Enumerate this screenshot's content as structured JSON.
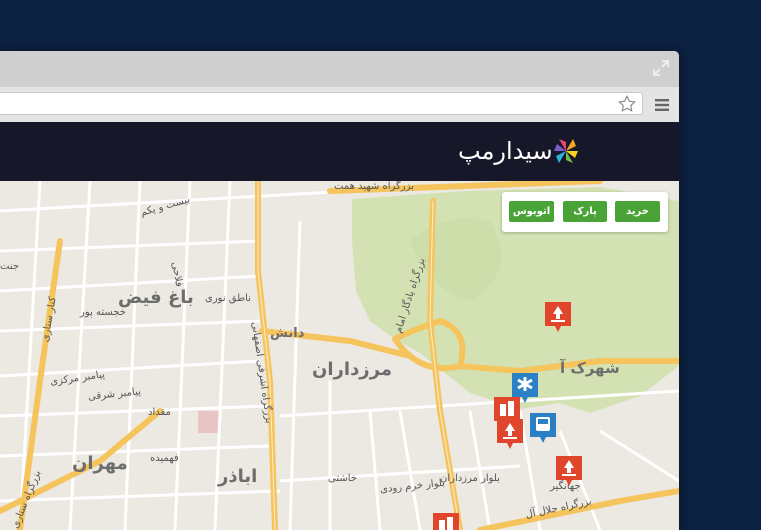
{
  "app": {
    "brand_name": "سیدارمپ"
  },
  "filters": [
    {
      "label": "خرید",
      "color": "#4aa337"
    },
    {
      "label": "پارک",
      "color": "#4aa337"
    },
    {
      "label": "اتوبوس",
      "color": "#4aa337"
    }
  ],
  "map": {
    "labels": {
      "bagh_feyz": "باغ فیض",
      "marzdaran": "مرزداران",
      "shahrak_ab": "شهرک آ",
      "mehran": "مهران",
      "abazar": "اباذر",
      "danesh": "دانش",
      "hemmat": "بزرگراه شهید همت",
      "yadegar": "بزرگراه یادگار امام",
      "ashrafi": "بزرگراه اشرفی اصفهانی",
      "sattari": "بزرگراه ستاری",
      "jalal": "بزرگراه جلال آل",
      "kanal": "کنار ستاری",
      "marzdaran_blvd": "بلوار مرزداران",
      "khorram": "بلوار خرم رودی",
      "khashti": "خاشتی",
      "nateq": "ناطق نوری",
      "khojaste": "خجسته پور",
      "payambar_markazi": "پیامبر مرکزی",
      "payambar_sharqi": "پیامبر شرقی",
      "meqdad": "مقداد",
      "bist": "بیست و یکم",
      "fahmideh": "فهمیده",
      "jenat": "جنت",
      "falahi": "فلاحی",
      "jahangir": "جهانگیر"
    },
    "markers": [
      {
        "type": "park",
        "color": "#e0462b"
      },
      {
        "type": "shopping",
        "color": "#e0462b"
      },
      {
        "type": "hospital",
        "color": "#2b7fc4"
      },
      {
        "type": "park",
        "color": "#e0462b"
      },
      {
        "type": "bus",
        "color": "#2b7fc4"
      },
      {
        "type": "park",
        "color": "#e0462b"
      },
      {
        "type": "shopping",
        "color": "#e0462b"
      }
    ]
  }
}
